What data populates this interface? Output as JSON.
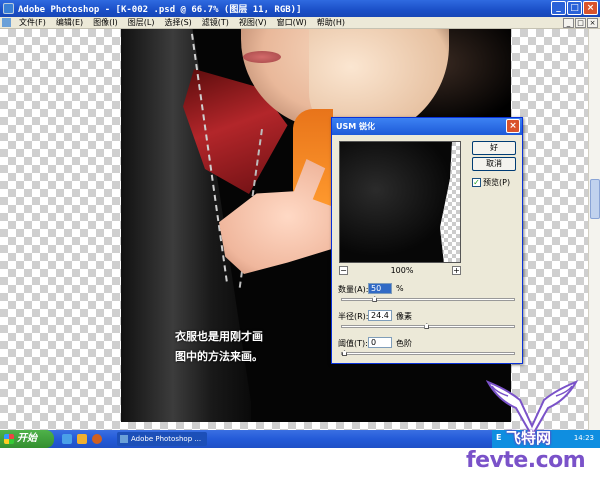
{
  "window": {
    "title": "Adobe Photoshop - [K-002 .psd @ 66.7% (图层 11, RGB)]",
    "controls": [
      "_",
      "□",
      "×"
    ]
  },
  "menubar": {
    "items": [
      "文件(F)",
      "编辑(E)",
      "图像(I)",
      "图层(L)",
      "选择(S)",
      "滤镜(T)",
      "视图(V)",
      "窗口(W)",
      "帮助(H)"
    ],
    "doc_controls": [
      "_",
      "□",
      "×"
    ]
  },
  "canvas": {
    "caption_line1": "衣服也是用刚才画",
    "caption_line2": "图中的方法来画。"
  },
  "dialog": {
    "title": "USM 锐化",
    "ok_label": "好",
    "cancel_label": "取消",
    "preview_label": "预览(P)",
    "preview_checked": true,
    "zoom_out": "−",
    "zoom_in": "+",
    "zoom_level": "100%",
    "amount": {
      "label": "数量(A):",
      "value": "50",
      "unit": "%",
      "position": 0.18
    },
    "radius": {
      "label": "半径(R):",
      "value": "24.4",
      "unit": "像素",
      "position": 0.49
    },
    "threshold": {
      "label": "阈值(T):",
      "value": "0",
      "unit": "色阶",
      "position": 0.0
    }
  },
  "taskbar": {
    "start_label": "开始",
    "task_label": "Adobe Photoshop ...",
    "lang": "E",
    "clock": "14:23"
  },
  "watermark": {
    "cn": "飞特网",
    "en": "fevte.com"
  },
  "colors": {
    "titlebar": "#1a4fc7",
    "dialog_bg": "#ece9d8",
    "watermark": "#7a52c9"
  }
}
